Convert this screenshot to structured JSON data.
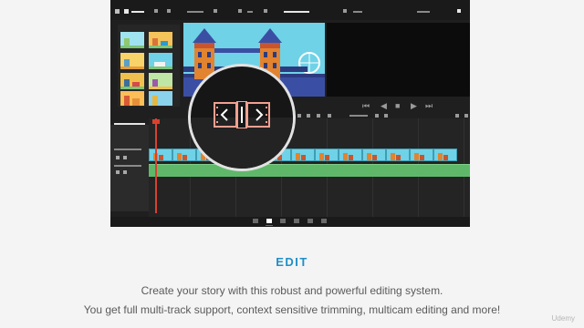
{
  "section": {
    "title": "EDIT",
    "line1": "Create your story with this robust and powerful editing system.",
    "line2": "You get full multi-track support, context sensitive trimming, multicam editing and more!"
  },
  "watermark": "Udemy",
  "app": {
    "transport_controls": [
      "skip-back",
      "frame-back",
      "stop",
      "play",
      "skip-forward"
    ],
    "zoom_icon": "split-trim-icon"
  },
  "colors": {
    "accent": "#1f8fc6",
    "playhead": "#d9412f",
    "video_clip": "#6fd2e7",
    "audio_track": "#5fb86a",
    "app_bg": "#1f1f1f"
  }
}
